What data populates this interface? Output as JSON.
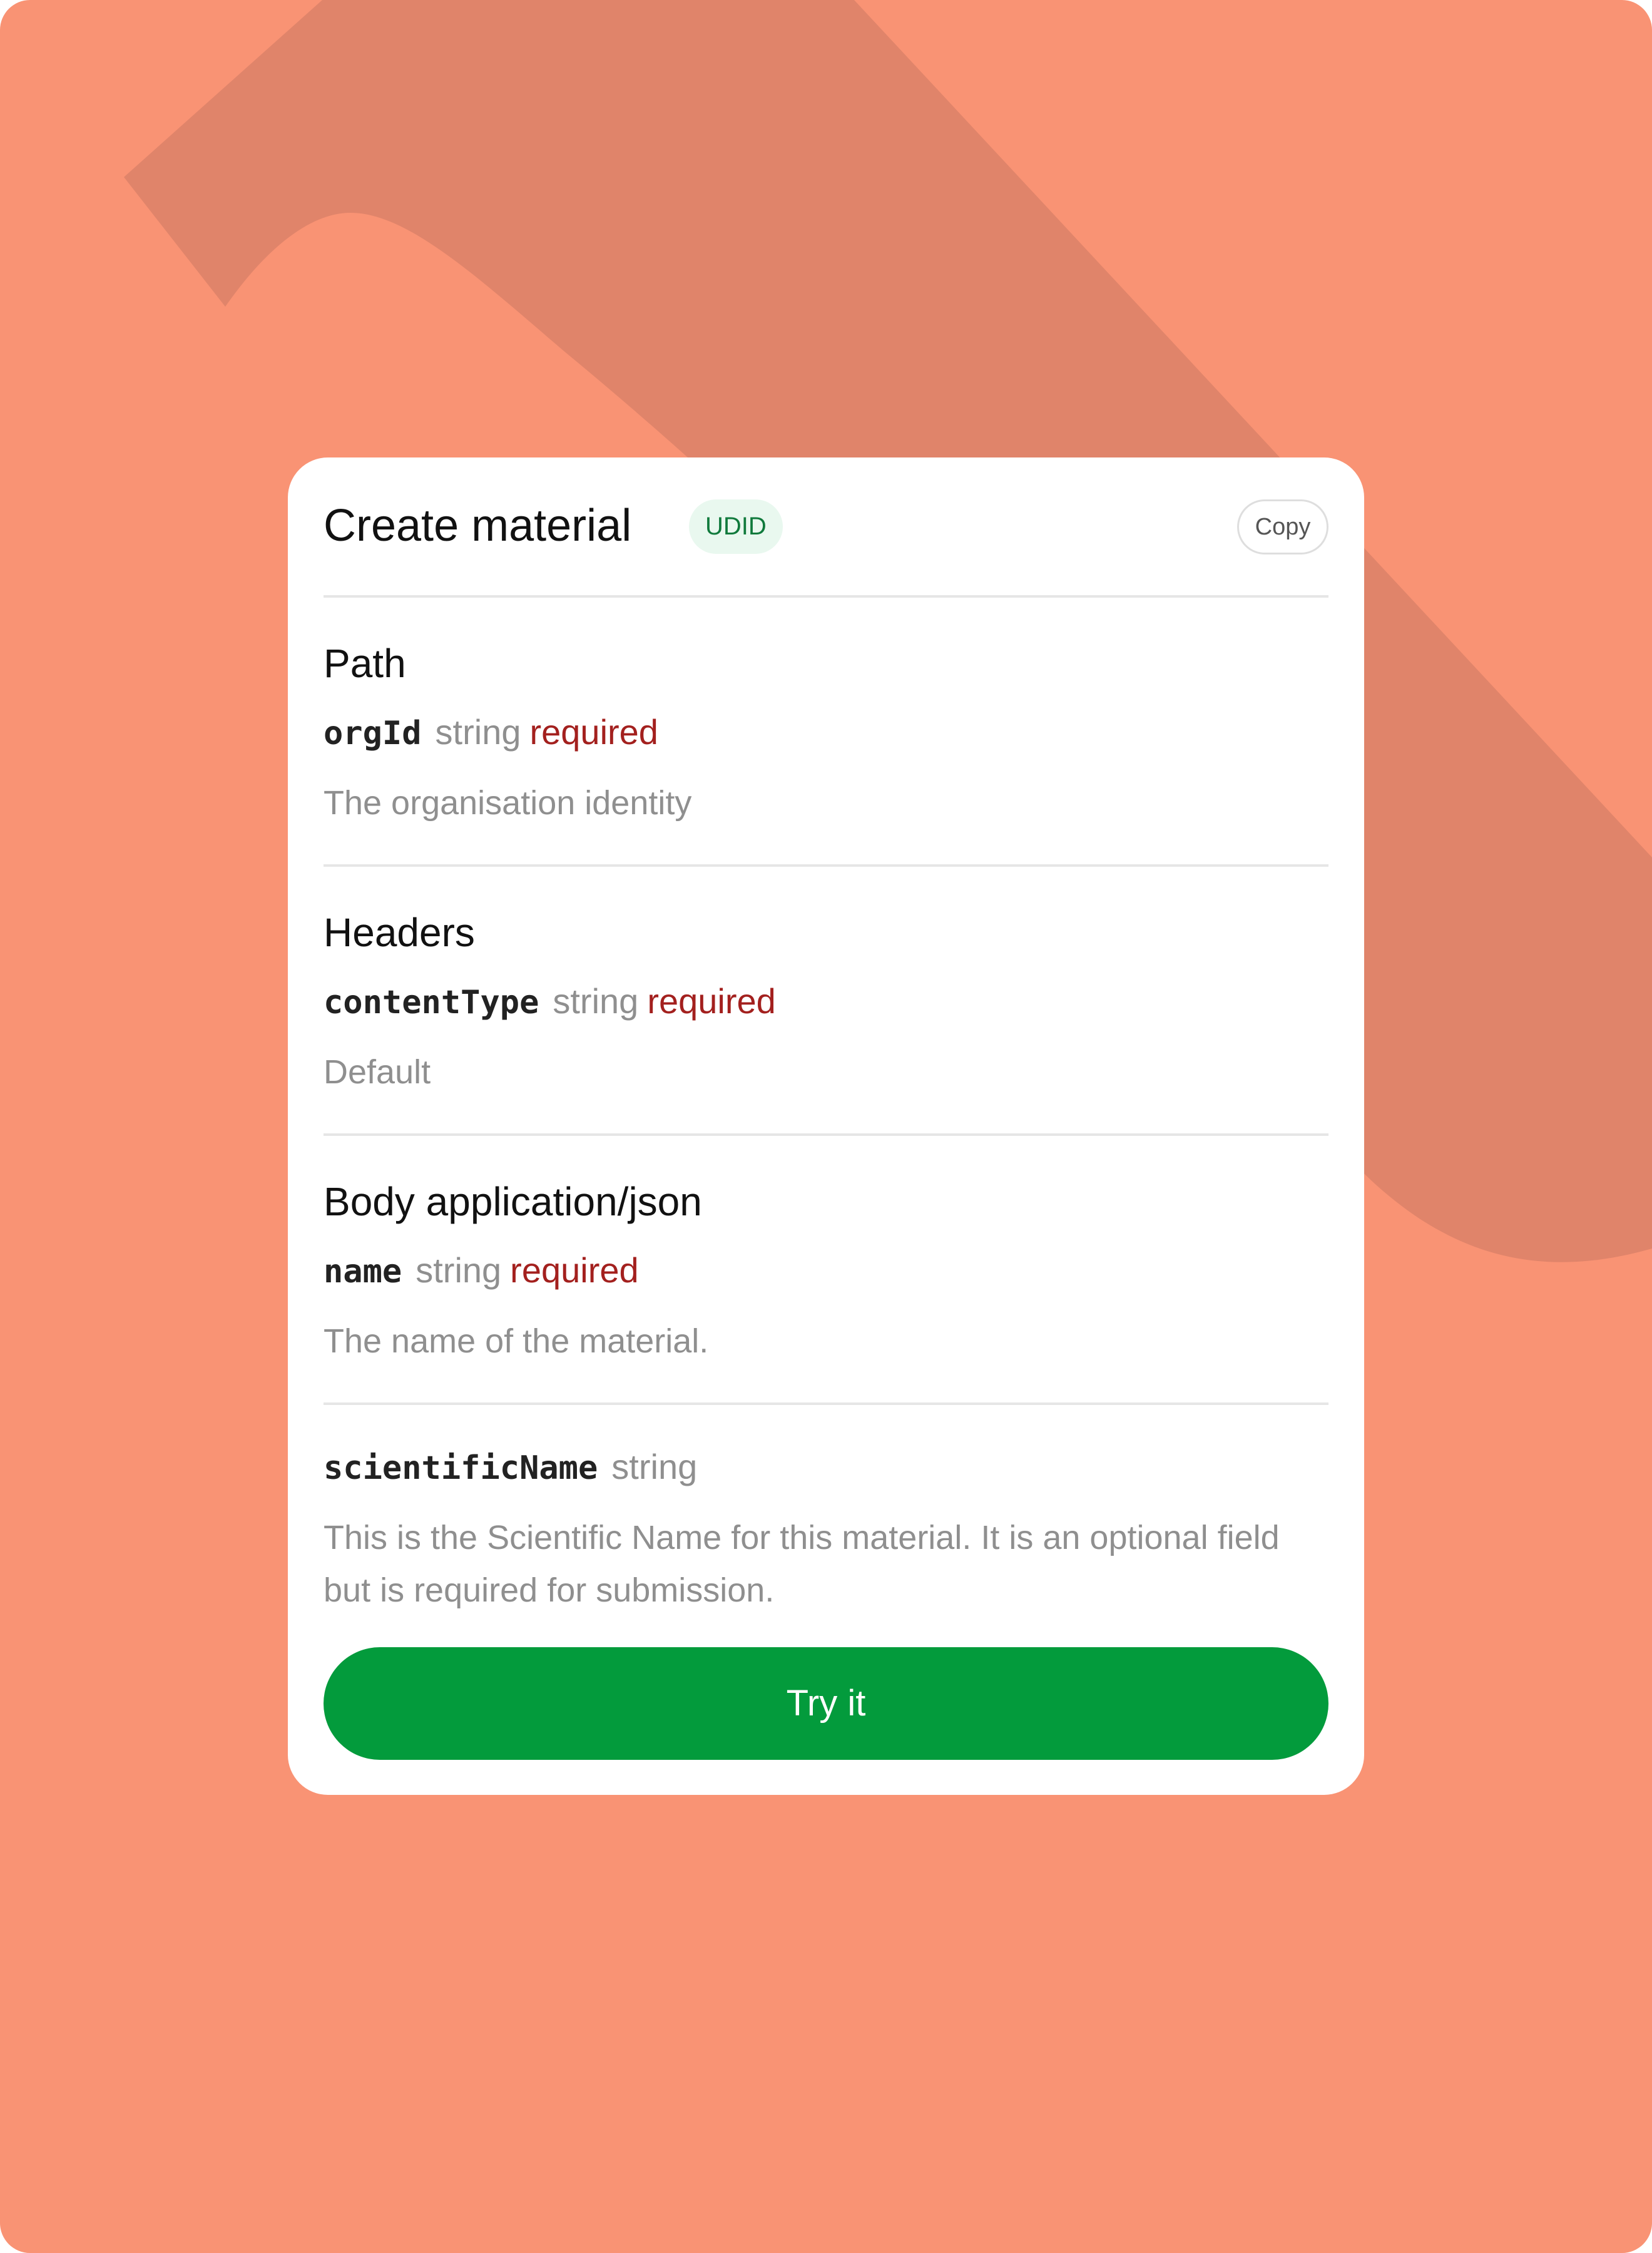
{
  "colors": {
    "background": "#f99374",
    "background_shape": "#e0846a",
    "card": "#ffffff",
    "badge_bg": "#e9f8ef",
    "badge_text": "#107a3c",
    "required": "#a3201e",
    "muted": "#8f8f8f",
    "primary_button": "#039b3c"
  },
  "card": {
    "title": "Create material",
    "badge": "UDID",
    "copy_label": "Copy"
  },
  "sections": [
    {
      "title": "Path",
      "param": {
        "name": "orgId",
        "type": "string",
        "required": "required",
        "description": "The organisation identity"
      }
    },
    {
      "title": "Headers",
      "param": {
        "name": "contentType",
        "type": "string",
        "required": "required",
        "description": "Default"
      }
    },
    {
      "title": "Body application/json",
      "param": {
        "name": "name",
        "type": "string",
        "required": "required",
        "description": "The name of the material."
      }
    },
    {
      "param": {
        "name": "scientificName",
        "type": "string",
        "description": "This is the Scientific Name for this material. It is an optional field but is required for submission."
      }
    }
  ],
  "action": {
    "label": "Try it"
  }
}
